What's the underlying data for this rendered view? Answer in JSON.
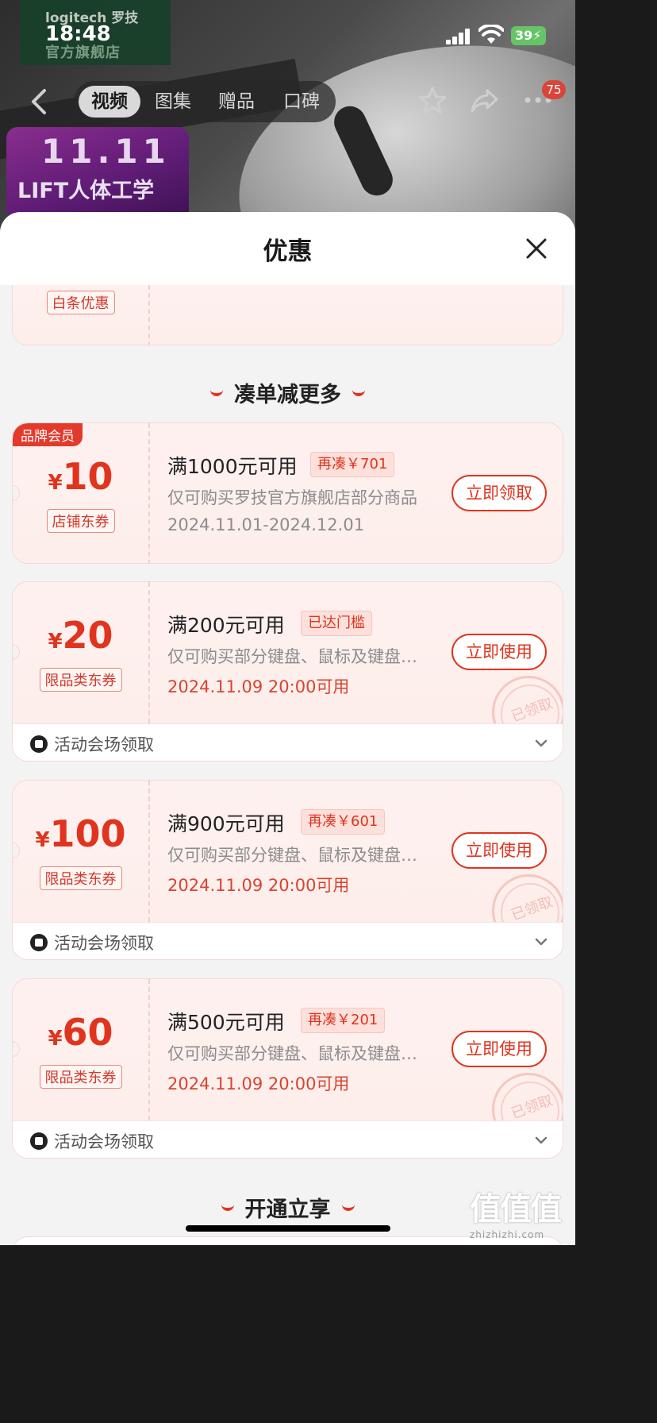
{
  "status_bar": {
    "time": "18:48",
    "battery": "39"
  },
  "store": {
    "logo_brand": "logitech 罗技",
    "logo_sub": "官方旗舰店"
  },
  "promo_badge": {
    "big": "11.11",
    "small": "LIFT人体工学"
  },
  "nav": {
    "tabs": [
      "视频",
      "图集",
      "赠品",
      "口碑"
    ],
    "active_tab": 0,
    "more_badge": "75"
  },
  "sheet": {
    "title": "优惠",
    "partial_coupon": {
      "type_tag": "白条优惠"
    },
    "section_1_title": "凑单减更多",
    "coupons": [
      {
        "ribbon": "品牌会员",
        "currency": "¥",
        "amount": "10",
        "type_tag": "店铺东券",
        "condition": "满1000元可用",
        "gap_tag": "再凑￥701",
        "scope": "仅可购买罗技官方旗舰店部分商品",
        "validity": "2024.11.01-2024.12.01",
        "validity_red": false,
        "action": "立即领取",
        "stamp": "",
        "footer": ""
      },
      {
        "ribbon": "",
        "currency": "¥",
        "amount": "20",
        "type_tag": "限品类东券",
        "condition": "满200元可用",
        "gap_tag": "已达门槛",
        "scope": "仅可购买部分键盘、鼠标及键盘…",
        "validity": "2024.11.09 20:00可用",
        "validity_red": true,
        "action": "立即使用",
        "stamp": "已领取",
        "footer": "活动会场领取"
      },
      {
        "ribbon": "",
        "currency": "¥",
        "amount": "100",
        "type_tag": "限品类东券",
        "condition": "满900元可用",
        "gap_tag": "再凑￥601",
        "scope": "仅可购买部分键盘、鼠标及键盘…",
        "validity": "2024.11.09 20:00可用",
        "validity_red": true,
        "action": "立即使用",
        "stamp": "已领取",
        "footer": "活动会场领取"
      },
      {
        "ribbon": "",
        "currency": "¥",
        "amount": "60",
        "type_tag": "限品类东券",
        "condition": "满500元可用",
        "gap_tag": "再凑￥201",
        "scope": "仅可购买部分键盘、鼠标及键盘…",
        "validity": "2024.11.09 20:00可用",
        "validity_red": true,
        "action": "立即使用",
        "stamp": "已领取",
        "footer": "活动会场领取"
      }
    ],
    "section_2_title": "开通立享"
  },
  "watermark": {
    "big": "值值值",
    "small": "zhizhizhi.com"
  },
  "colors": {
    "accent": "#e0341f",
    "sheet_bg": "#f3f3f3",
    "coupon_bg": "#fdf1ef"
  },
  "icons": [
    "back-icon",
    "star-icon",
    "share-icon",
    "more-icon",
    "close-icon",
    "chevron-down-icon",
    "coupon-source-icon"
  ]
}
